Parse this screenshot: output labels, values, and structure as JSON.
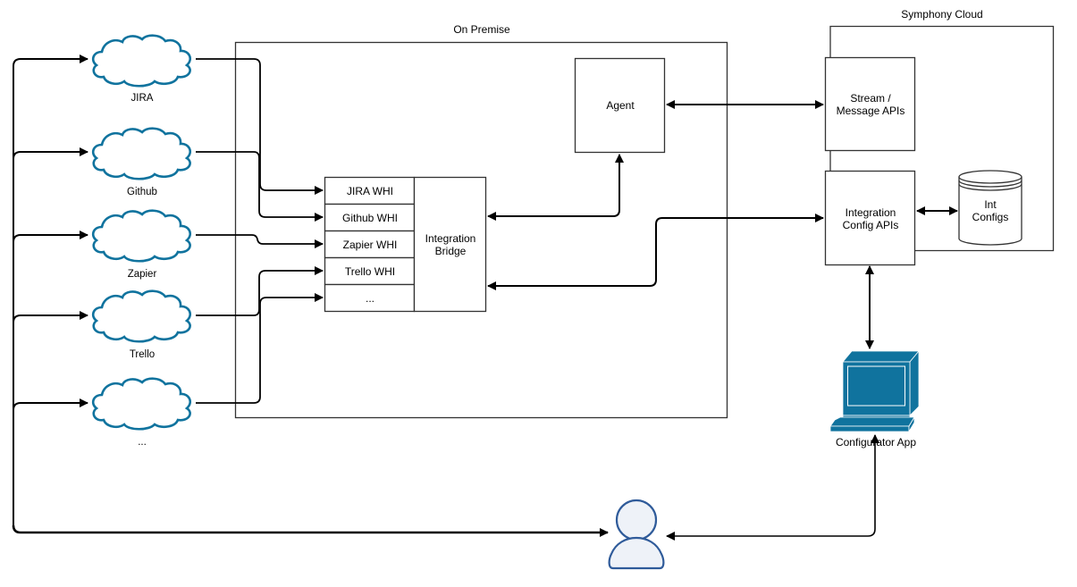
{
  "colors": {
    "cloud_stroke": "#10739e",
    "computer_fill": "#10739e",
    "user_stroke": "#2f5b9a",
    "user_fill": "#eef2f8",
    "line": "#000000",
    "box_stroke": "#333333"
  },
  "containers": {
    "on_premise": "On Premise",
    "symphony_cloud": "Symphony Cloud"
  },
  "clouds": [
    {
      "label": "JIRA",
      "icon": "cloud-icon"
    },
    {
      "label": "Github",
      "icon": "cloud-icon"
    },
    {
      "label": "Zapier",
      "icon": "cloud-icon"
    },
    {
      "label": "Trello",
      "icon": "cloud-icon"
    },
    {
      "label": "...",
      "icon": "cloud-icon"
    }
  ],
  "webhook_handlers": [
    "JIRA WHI",
    "Github WHI",
    "Zapier WHI",
    "Trello WHI",
    "..."
  ],
  "integration_bridge": "Integration\nBridge",
  "agent": "Agent",
  "stream_apis": "Stream /\nMessage APIs",
  "config_apis": "Integration\nConfig APIs",
  "int_configs": "Int\nConfigs",
  "configurator_app": "Configurator App",
  "user_icon": "user-icon",
  "computer_icon": "computer-icon",
  "database_icon": "database-icon"
}
